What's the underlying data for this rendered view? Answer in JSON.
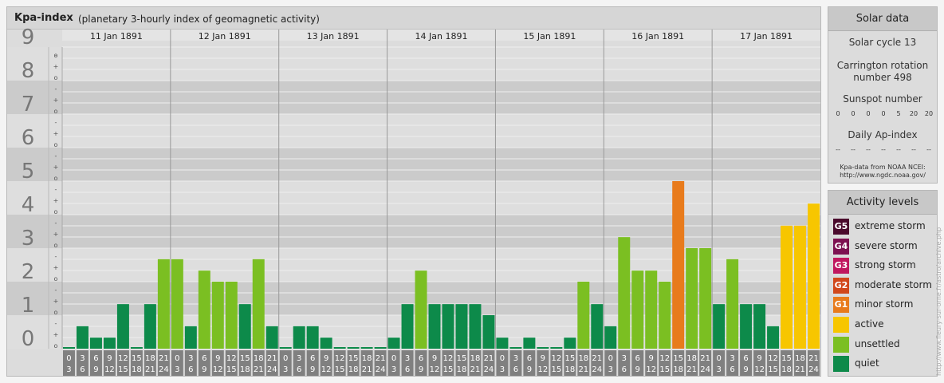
{
  "chart_data": {
    "type": "bar",
    "title": "Kpa-index",
    "subtitle": "(planetary 3-hourly index of geomagnetic activity)",
    "ylim": [
      0,
      9
    ],
    "y_ticks": [
      "0",
      "1",
      "2",
      "3",
      "4",
      "5",
      "6",
      "7",
      "8",
      "9"
    ],
    "minor_ticks": [
      "o",
      "+",
      "-"
    ],
    "days": [
      {
        "label": "11 Jan 1891",
        "values": [
          0.0,
          0.67,
          0.33,
          0.33,
          1.33,
          0.0,
          1.33,
          2.67
        ]
      },
      {
        "label": "12 Jan 1891",
        "values": [
          2.67,
          0.67,
          2.33,
          2.0,
          2.0,
          1.33,
          2.67,
          0.67
        ]
      },
      {
        "label": "13 Jan 1891",
        "values": [
          0.0,
          0.67,
          0.67,
          0.33,
          0.0,
          0.0,
          0.0,
          0.0
        ]
      },
      {
        "label": "14 Jan 1891",
        "values": [
          0.33,
          1.33,
          2.33,
          1.33,
          1.33,
          1.33,
          1.33,
          1.0
        ]
      },
      {
        "label": "15 Jan 1891",
        "values": [
          0.33,
          0.0,
          0.33,
          0.0,
          0.0,
          0.33,
          2.0,
          1.33
        ]
      },
      {
        "label": "16 Jan 1891",
        "values": [
          0.67,
          3.33,
          2.33,
          2.33,
          2.0,
          5.0,
          3.0,
          3.0
        ]
      },
      {
        "label": "17 Jan 1891",
        "values": [
          1.33,
          2.67,
          1.33,
          1.33,
          0.67,
          3.67,
          3.67,
          4.33
        ]
      }
    ],
    "hour_labels": [
      [
        "0",
        "3"
      ],
      [
        "3",
        "6"
      ],
      [
        "6",
        "9"
      ],
      [
        "9",
        "12"
      ],
      [
        "12",
        "15"
      ],
      [
        "15",
        "18"
      ],
      [
        "18",
        "21"
      ],
      [
        "21",
        "24"
      ]
    ],
    "colors": {
      "quiet": "#0d8a4a",
      "unsettled": "#7bbf22",
      "active": "#f7c600",
      "G1": "#e87b1c",
      "G2": "#d1471b",
      "G3": "#c0175e",
      "G4": "#7d1150",
      "G5": "#4a0a2c"
    }
  },
  "solar": {
    "title": "Solar data",
    "cycle": "Solar cycle 13",
    "carrington_line1": "Carrington rotation",
    "carrington_line2": "number 498",
    "sunspot_title": "Sunspot number",
    "sunspot_values": [
      "0",
      "0",
      "0",
      "0",
      "5",
      "20",
      "20"
    ],
    "ap_title": "Daily Ap-index",
    "ap_values": [
      "--",
      "--",
      "--",
      "--",
      "--",
      "--",
      "--"
    ],
    "source_line1": "Kpa-data from NOAA NCEI:",
    "source_line2": "http://www.ngdc.noaa.gov/"
  },
  "levels": {
    "title": "Activity levels",
    "items": [
      {
        "badge": "G5",
        "label": "extreme storm",
        "color": "#4a0a2c"
      },
      {
        "badge": "G4",
        "label": "severe storm",
        "color": "#7d1150"
      },
      {
        "badge": "G3",
        "label": "strong storm",
        "color": "#c0175e"
      },
      {
        "badge": "G2",
        "label": "moderate storm",
        "color": "#d1471b"
      },
      {
        "badge": "G1",
        "label": "minor storm",
        "color": "#e87b1c"
      },
      {
        "badge": "",
        "label": "active",
        "color": "#f7c600"
      },
      {
        "badge": "",
        "label": "unsettled",
        "color": "#7bbf22"
      },
      {
        "badge": "",
        "label": "quiet",
        "color": "#0d8a4a"
      }
    ]
  },
  "credit": "http://www.fleury-sur-orne.fr/astro/archive.php"
}
